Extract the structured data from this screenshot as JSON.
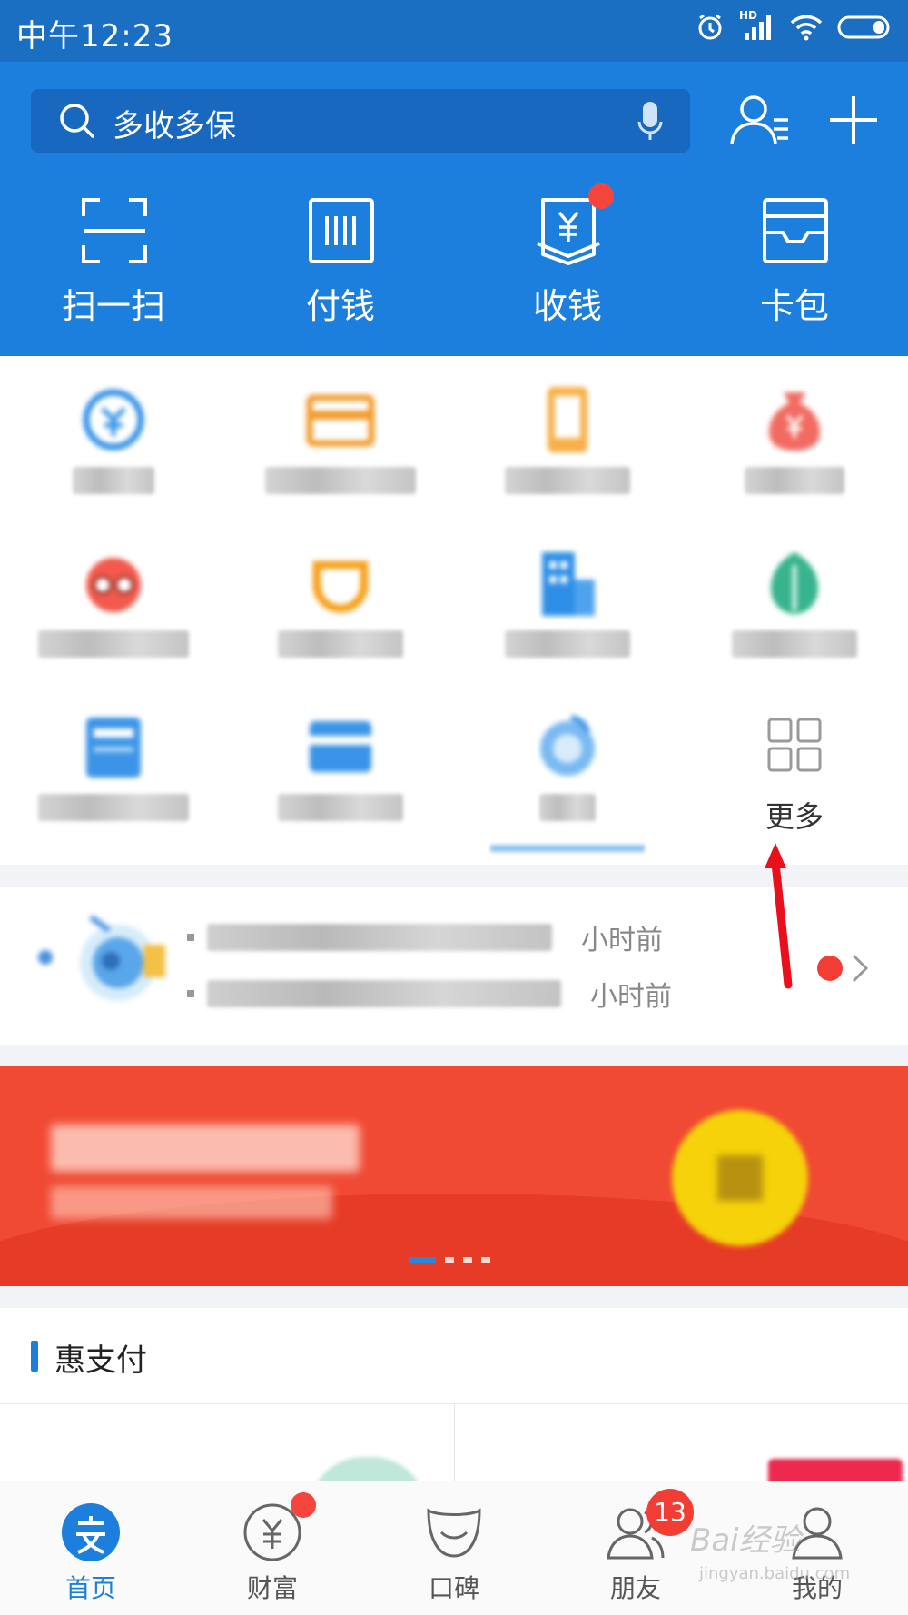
{
  "status_bar": {
    "time": "中午12:23",
    "network": "HD"
  },
  "search": {
    "placeholder": "多收多保"
  },
  "quick_actions": [
    {
      "label": "扫一扫",
      "icon": "scan-icon"
    },
    {
      "label": "付钱",
      "icon": "barcode-icon"
    },
    {
      "label": "收钱",
      "icon": "receive-money-icon"
    },
    {
      "label": "卡包",
      "icon": "card-wallet-icon"
    }
  ],
  "grid": {
    "more_label": "更多"
  },
  "notifications": [
    {
      "time_text": "小时前"
    },
    {
      "time_text": "小时前"
    }
  ],
  "section": {
    "title": "惠支付"
  },
  "tabs": [
    {
      "label": "首页",
      "icon": "home-icon",
      "active": true
    },
    {
      "label": "财富",
      "icon": "wealth-icon",
      "active": false
    },
    {
      "label": "口碑",
      "icon": "koubei-icon",
      "active": false
    },
    {
      "label": "朋友",
      "icon": "friends-icon",
      "active": false,
      "badge": "13"
    },
    {
      "label": "我的",
      "icon": "profile-icon",
      "active": false
    }
  ],
  "watermark": {
    "brand": "Bai经验",
    "url": "jingyan.baidu.com"
  },
  "colors": {
    "primary": "#1c7fdd",
    "header_dark": "#1a6fc2",
    "red": "#f23d34",
    "banner": "#f04a34"
  }
}
